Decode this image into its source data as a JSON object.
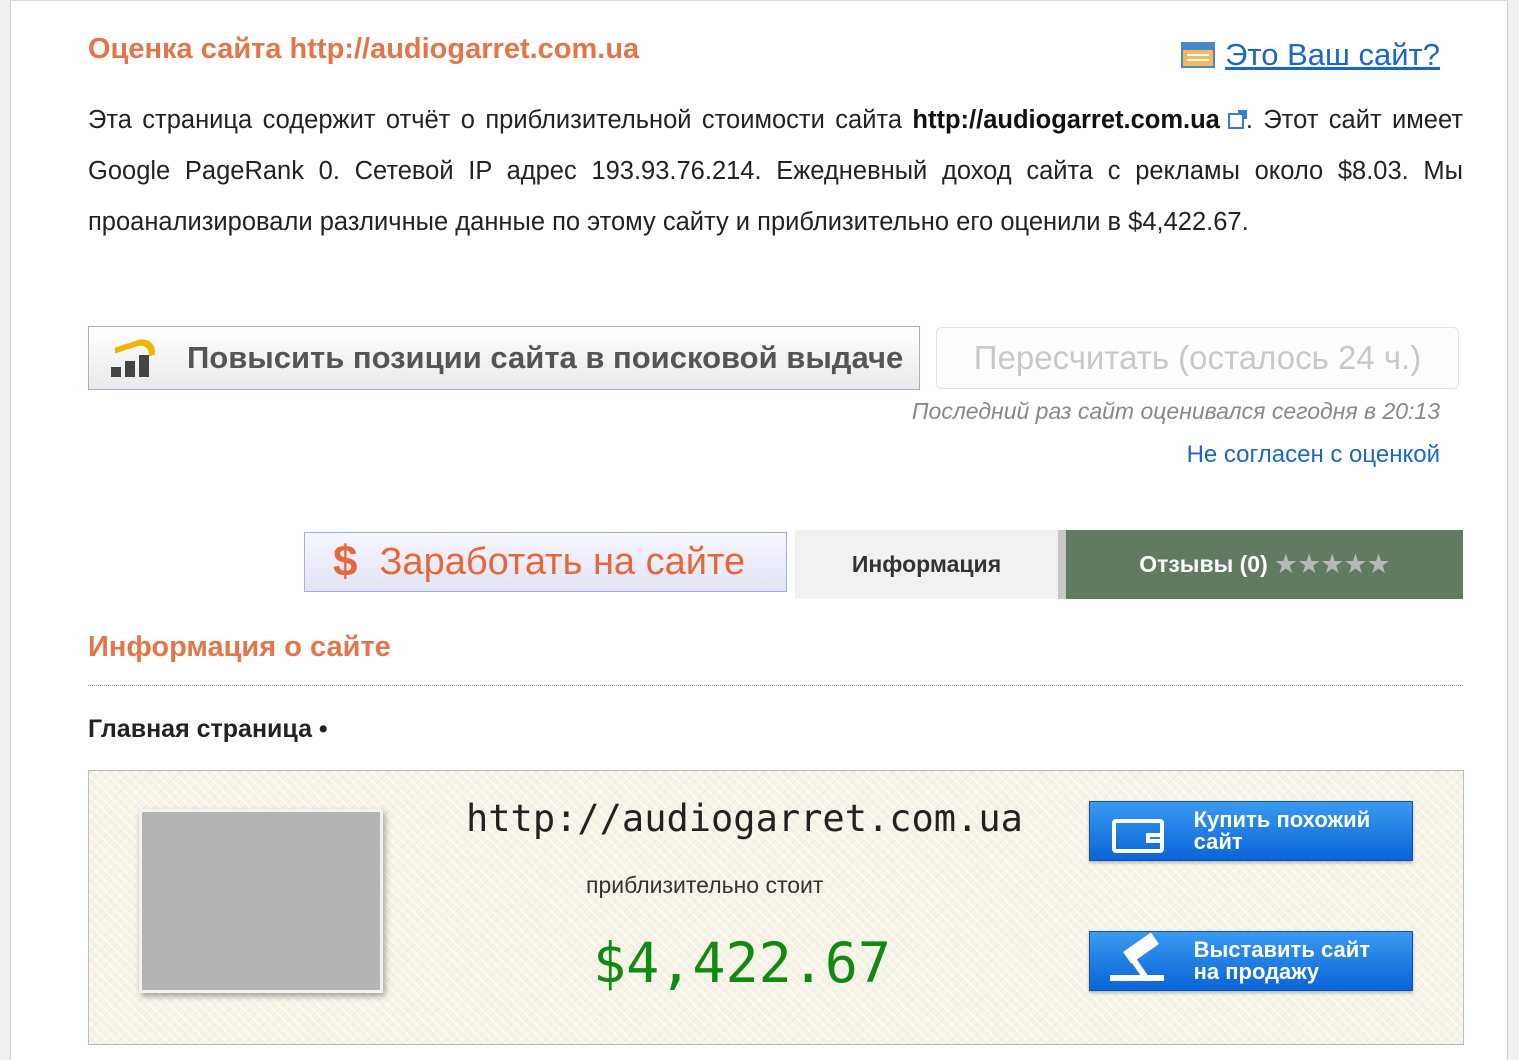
{
  "header": {
    "title": "Оценка сайта http://audiogarret.com.ua",
    "owner_link": "Это Ваш сайт?"
  },
  "description": {
    "part1": "Эта страница содержит отчёт о приблизительной стоимости сайта ",
    "site": "http://audiogarret.com.ua",
    "part2": ". Этот сайт имеет Google PageRank 0. Сетевой IP адрес 193.93.76.214. Ежедневный доход сайта с рекламы около $8.03. Мы проанализировали различные данные по этому сайту и приблизительно его оценили в $4,422.67."
  },
  "actions": {
    "promote_label": "Повысить позиции сайта в поисковой выдаче",
    "recalc_label": "Пересчитать (осталось 24 ч.)",
    "last_evaluated": "Последний раз сайт оценивался сегодня в 20:13",
    "disagree_link": "Не согласен с оценкой"
  },
  "tabs": {
    "earn_symbol": "$",
    "earn_label": "Заработать на сайте",
    "info_label": "Информация",
    "reviews_label": "Отзывы (0)",
    "reviews_stars": "★★★★★"
  },
  "section": {
    "title": "Информация о сайте",
    "home_label": "Главная страница •"
  },
  "valuation": {
    "url": "http://audiogarret.com.ua",
    "approx_label": "приблизительно стоит",
    "price": "$4,422.67",
    "buy_label": "Купить похожий\nсайт",
    "sell_label": "Выставить сайт\nна продажу"
  },
  "icons": {
    "owner": "browser-window-icon",
    "external": "external-link-icon",
    "promote": "chart-growth-icon",
    "buy": "wallet-icon",
    "sell": "gavel-icon"
  },
  "colors": {
    "heading_orange": "#e2764a",
    "link_blue": "#1a67c4",
    "reviews_tab_green": "#627a61",
    "price_green": "#118a11",
    "action_blue": "#0a64d8"
  }
}
